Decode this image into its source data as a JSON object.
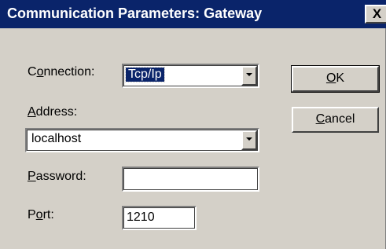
{
  "window": {
    "title": "Communication Parameters: Gateway",
    "close_glyph": "X"
  },
  "connection": {
    "label_accel": "o",
    "label_pre": "C",
    "label_post": "nnection:",
    "value": "Tcp/Ip"
  },
  "address": {
    "label_accel": "A",
    "label_post": "ddress:",
    "value": "localhost"
  },
  "password": {
    "label_accel": "P",
    "label_post": "assword:",
    "value": ""
  },
  "port": {
    "label_pre": "P",
    "label_accel": "o",
    "label_post": "rt:",
    "value": "1210"
  },
  "buttons": {
    "ok_accel": "O",
    "ok_post": "K",
    "cancel_accel": "C",
    "cancel_post": "ancel"
  },
  "icons": {
    "close": "close-icon",
    "dropdown": "chevron-down-icon"
  },
  "colors": {
    "titlebar": "#0a246a",
    "face": "#d4d0c8",
    "selection": "#0a246a"
  }
}
